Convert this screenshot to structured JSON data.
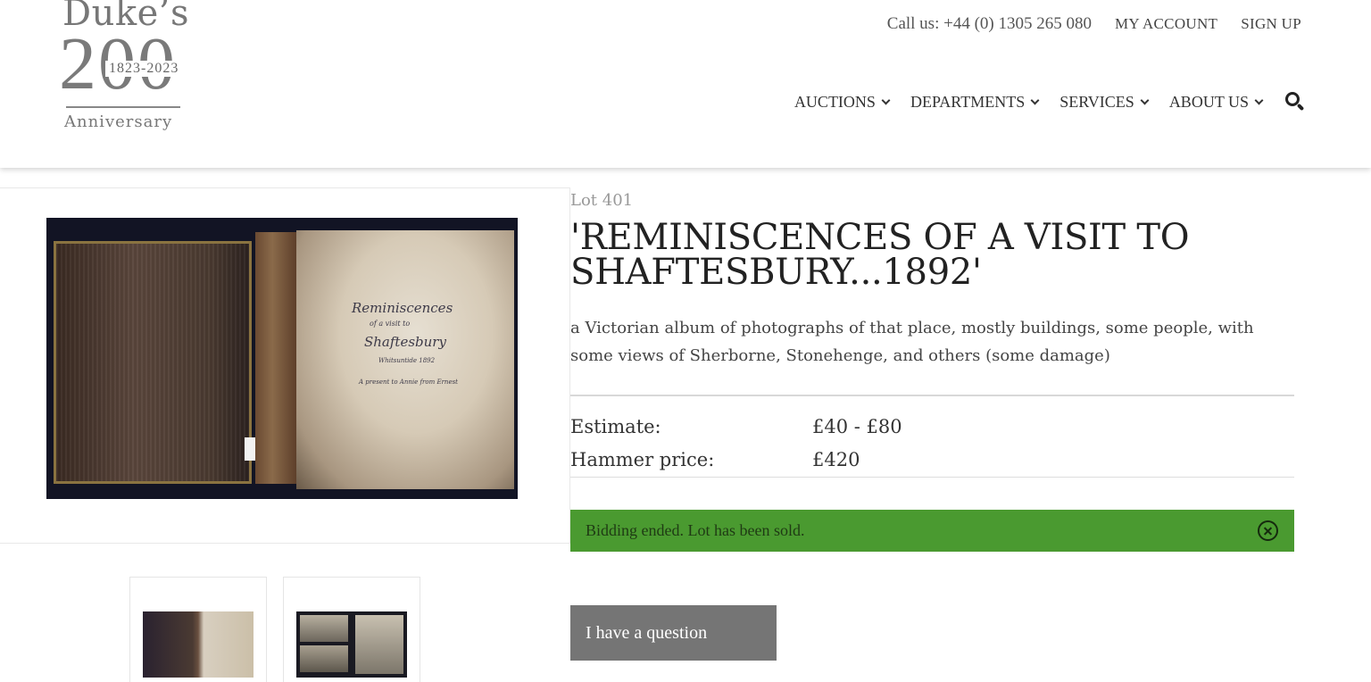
{
  "logo": {
    "name": "Duke’s",
    "number": "200",
    "years": "1823-2023",
    "tagline": "Anniversary"
  },
  "header": {
    "call": "Call us: +44 (0) 1305 265 080",
    "my_account": "MY ACCOUNT",
    "sign_up": "SIGN UP"
  },
  "nav": {
    "items": [
      {
        "label": "AUCTIONS"
      },
      {
        "label": "DEPARTMENTS"
      },
      {
        "label": "SERVICES"
      },
      {
        "label": "ABOUT US"
      }
    ],
    "search_icon": "search-icon"
  },
  "photo": {
    "script_lines": [
      "Reminiscences",
      "of a visit to",
      "Shaftesbury",
      "Whitsuntide 1892",
      "A present to Annie from Ernest"
    ]
  },
  "lot": {
    "number": "Lot 401",
    "title": "'REMINISCENCES OF A VISIT TO SHAFTESBURY...1892'",
    "description": "a Victorian album of photographs of that place, mostly buildings, some people, with some views of Sherborne, Stonehenge, and others (some damage)",
    "estimate_label": "Estimate:",
    "estimate_value": "£40 - £80",
    "hammer_label": "Hammer price:",
    "hammer_value": "£420"
  },
  "status": {
    "message": "Bidding ended. Lot has been sold.",
    "color": "#4a9a30"
  },
  "question_button": "I have a question"
}
